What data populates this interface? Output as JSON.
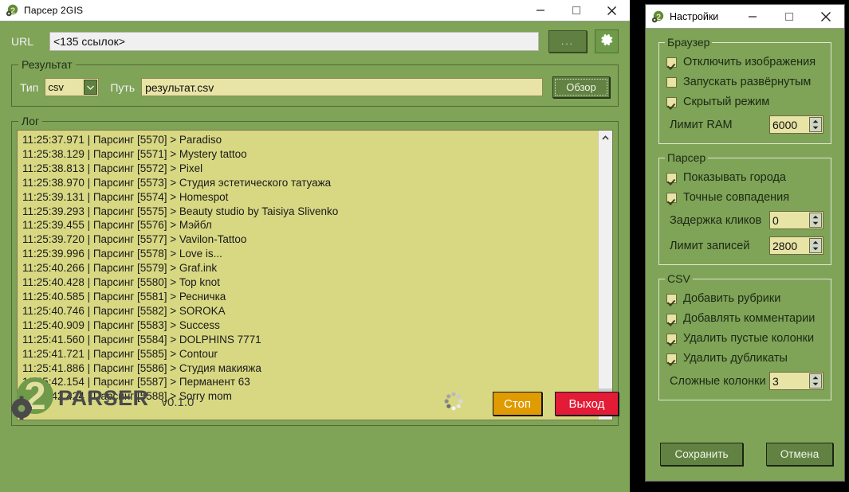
{
  "main_window": {
    "title": "Парсер 2GIS",
    "icon": "app-2parser-icon",
    "controls": {
      "minimize": "minimize-icon",
      "maximize": "maximize-icon",
      "close": "close-icon"
    },
    "url": {
      "label": "URL",
      "value": "<135 ссылок>",
      "placeholder": "",
      "browse_label": "...",
      "settings_icon": "gear-icon"
    },
    "result_group": {
      "title": "Результат",
      "type_label": "Тип",
      "type_value": "csv",
      "type_options": [
        "csv"
      ],
      "path_label": "Путь",
      "path_value": "результат.csv",
      "browse_button": "Обзор"
    },
    "log_group": {
      "title": "Лог",
      "lines": [
        "11:25:37.971 | Парсинг [5570] > Paradiso",
        "11:25:38.129 | Парсинг [5571] > Mystery tattoo",
        "11:25:38.813 | Парсинг [5572] > Pixel",
        "11:25:38.970 | Парсинг [5573] > Студия эстетического татуажа",
        "11:25:39.131 | Парсинг [5574] > Homespot",
        "11:25:39.293 | Парсинг [5575] > Beauty studio by Taisiya Slivenko",
        "11:25:39.455 | Парсинг [5576] > Мэйбл",
        "11:25:39.720 | Парсинг [5577] > Vavilon-Tattoo",
        "11:25:39.996 | Парсинг [5578] > Love is...",
        "11:25:40.266 | Парсинг [5579] > Graf.ink",
        "11:25:40.428 | Парсинг [5580] > Top knot",
        "11:25:40.585 | Парсинг [5581] > Ресничка",
        "11:25:40.746 | Парсинг [5582] > SOROKA",
        "11:25:40.909 | Парсинг [5583] > Success",
        "11:25:41.560 | Парсинг [5584] > DOLPHINS 7771",
        "11:25:41.721 | Парсинг [5585] > Contour",
        "11:25:41.886 | Парсинг [5586] > Студия макияжа",
        "11:25:42.154 | Парсинг [5587] > Перманент 63",
        "11:25:42.424 | Парсинг [5588] > Sorry mom"
      ]
    },
    "footer": {
      "logo_digit": "2",
      "logo_word": "PARSER",
      "version": "v0.1.0",
      "spinner": "loading-spinner-icon",
      "stop_button": "Стоп",
      "exit_button": "Выход",
      "stop_color": "#e09b00",
      "exit_color": "#e31b37"
    }
  },
  "settings_window": {
    "title": "Настройки",
    "icon": "app-2parser-icon",
    "controls": {
      "minimize": "minimize-icon",
      "maximize": "maximize-icon",
      "close": "close-icon"
    },
    "browser_group": {
      "title": "Браузер",
      "checkboxes": [
        {
          "label": "Отключить изображения",
          "checked": true
        },
        {
          "label": "Запускать развёрнутым",
          "checked": false
        },
        {
          "label": "Скрытый режим",
          "checked": true
        }
      ],
      "spinners": [
        {
          "label": "Лимит RAM",
          "value": "6000"
        }
      ]
    },
    "parser_group": {
      "title": "Парсер",
      "checkboxes": [
        {
          "label": "Показывать города",
          "checked": true
        },
        {
          "label": "Точные совпадения",
          "checked": true
        }
      ],
      "spinners": [
        {
          "label": "Задержка кликов",
          "value": "0"
        },
        {
          "label": "Лимит записей",
          "value": "2800"
        }
      ]
    },
    "csv_group": {
      "title": "CSV",
      "checkboxes": [
        {
          "label": "Добавить рубрики",
          "checked": true
        },
        {
          "label": "Добавлять комментарии",
          "checked": true
        },
        {
          "label": "Удалить пустые колонки",
          "checked": true
        },
        {
          "label": "Удалить дубликаты",
          "checked": true
        }
      ],
      "spinners": [
        {
          "label": "Сложные колонки",
          "value": "3"
        }
      ]
    },
    "footer": {
      "save_button": "Сохранить",
      "cancel_button": "Отмена"
    }
  },
  "theme": {
    "window_bg": "#7fa357",
    "field_bg": "#e8e4a5",
    "log_bg": "#d8d883",
    "accent_green": "#628243"
  }
}
